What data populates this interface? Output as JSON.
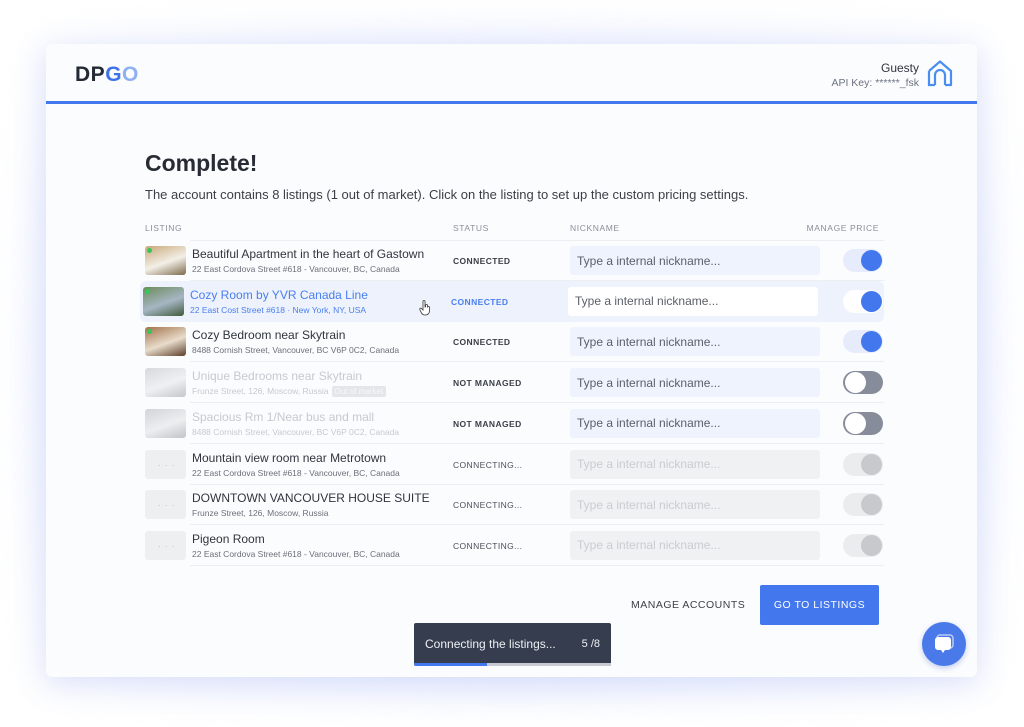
{
  "brand": {
    "logo_part1": "DP",
    "logo_part2": "G",
    "logo_part3": "O",
    "accent": "#4377ee"
  },
  "account": {
    "name": "Guesty",
    "api_key": "API Key: ******_fsk",
    "icon": "home-icon"
  },
  "page": {
    "title": "Complete!",
    "subtitle": "The account contains 8 listings (1 out of market). Click on the listing to set up the custom pricing settings."
  },
  "table": {
    "headers": {
      "listing": "LISTING",
      "status": "STATUS",
      "nickname": "NICKNAME",
      "manage_price": "MANAGE PRICE"
    },
    "nickname_placeholder": "Type a internal nickname...",
    "rows": [
      {
        "name": "Beautiful Apartment in the heart of Gastown",
        "address": "22 East Cordova Street #618 - Vancouver, BC, Canada",
        "status": "CONNECTED",
        "manage_price": "on",
        "online": true
      },
      {
        "name": "Cozy Room by YVR Canada Line",
        "address": "22 East Cost Street #618 · New York, NY, USA",
        "status": "CONNECTED",
        "manage_price": "on",
        "online": true,
        "hovered": true
      },
      {
        "name": "Cozy Bedroom near Skytrain",
        "address": "8488 Cornish Street, Vancouver, BC V6P 0C2, Canada",
        "status": "CONNECTED",
        "manage_price": "on",
        "online": true
      },
      {
        "name": "Unique Bedrooms near Skytrain",
        "address": "Frunze Street, 126, Moscow, Russia",
        "badge": "Out of market",
        "status": "NOT MANAGED",
        "manage_price": "off"
      },
      {
        "name": "Spacious Rm 1/Near bus and mall",
        "address": "8488 Cornish Street, Vancouver, BC V6P 0C2, Canada",
        "status": "NOT MANAGED",
        "manage_price": "off"
      },
      {
        "name": "Mountain view room near Metrotown",
        "address": "22 East Cordova Street #618 - Vancouver, BC, Canada",
        "status": "CONNECTING...",
        "manage_price": "disabled"
      },
      {
        "name": "DOWNTOWN VANCOUVER HOUSE SUITE",
        "address": "Frunze Street, 126, Moscow, Russia",
        "status": "CONNECTING...",
        "manage_price": "disabled"
      },
      {
        "name": "Pigeon Room",
        "address": "22 East Cordova Street #618 - Vancouver, BC, Canada",
        "status": "CONNECTING...",
        "manage_price": "disabled"
      }
    ]
  },
  "actions": {
    "manage_accounts": "MANAGE ACCOUNTS",
    "go_to_listings": "GO TO LISTINGS"
  },
  "toast": {
    "text": "Connecting the listings...",
    "count": "5 /8",
    "progress_percent": 37
  },
  "chat": {
    "icon": "chat-icon"
  }
}
